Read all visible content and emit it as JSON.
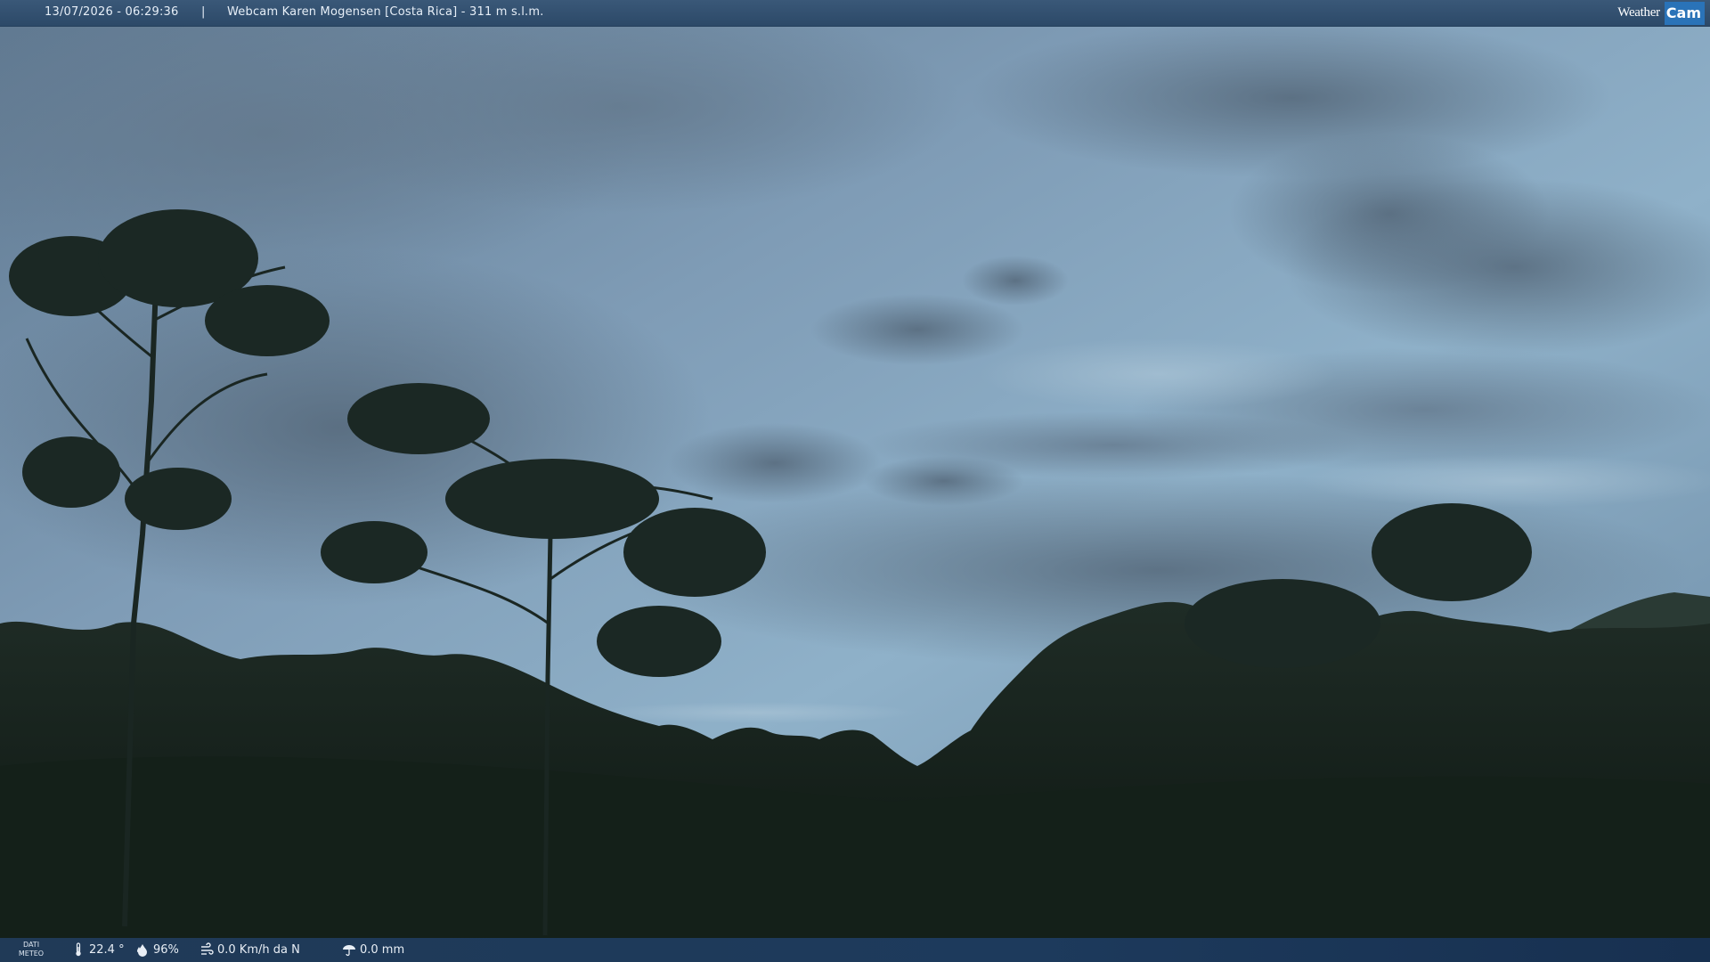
{
  "header": {
    "datetime": "13/07/2026 - 06:29:36",
    "separator": "|",
    "title": "Webcam Karen Mogensen [Costa Rica] - 311 m s.l.m.",
    "logo_weather": "Weather",
    "logo_cam": "Cam"
  },
  "footer": {
    "label_line1": "DATI",
    "label_line2": "METEO",
    "temperature": "22.4 °",
    "humidity": "96%",
    "wind": "0.0 Km/h da N",
    "rain": "0.0 mm",
    "icons": [
      "thermometer-icon",
      "humidity-icon",
      "wind-icon",
      "rain-gauge-icon"
    ]
  },
  "colors": {
    "bar": "#2c4968",
    "sky_top": "#6f8aa3",
    "foliage": "#0f1a14"
  }
}
